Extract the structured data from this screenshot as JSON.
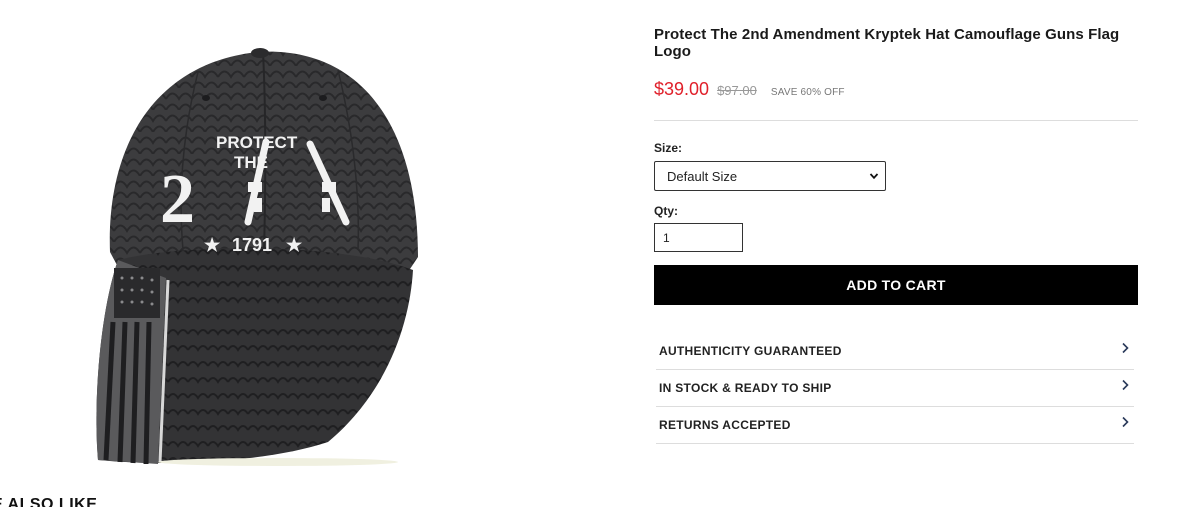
{
  "product": {
    "title": "Protect The 2nd Amendment Kryptek Hat Camouflage Guns Flag Logo",
    "price": "$39.00",
    "compare_price": "$97.00",
    "save_text": "SAVE 60% OFF",
    "image": {
      "embroidery_protect": "PROTECT",
      "embroidery_the": "THE",
      "embroidery_number": "2",
      "embroidery_year": "1791"
    }
  },
  "options": {
    "size_label": "Size:",
    "size_value": "Default Size",
    "qty_label": "Qty:",
    "qty_value": "1"
  },
  "cart": {
    "add_label": "ADD TO CART"
  },
  "accordion": [
    {
      "label": "AUTHENTICITY GUARANTEED"
    },
    {
      "label": "IN STOCK & READY TO SHIP"
    },
    {
      "label": "RETURNS ACCEPTED"
    }
  ],
  "related": {
    "heading": "E ALSO LIKE"
  },
  "colors": {
    "price": "#e0202a",
    "button": "#000000",
    "hat": "#3a3a3c"
  }
}
